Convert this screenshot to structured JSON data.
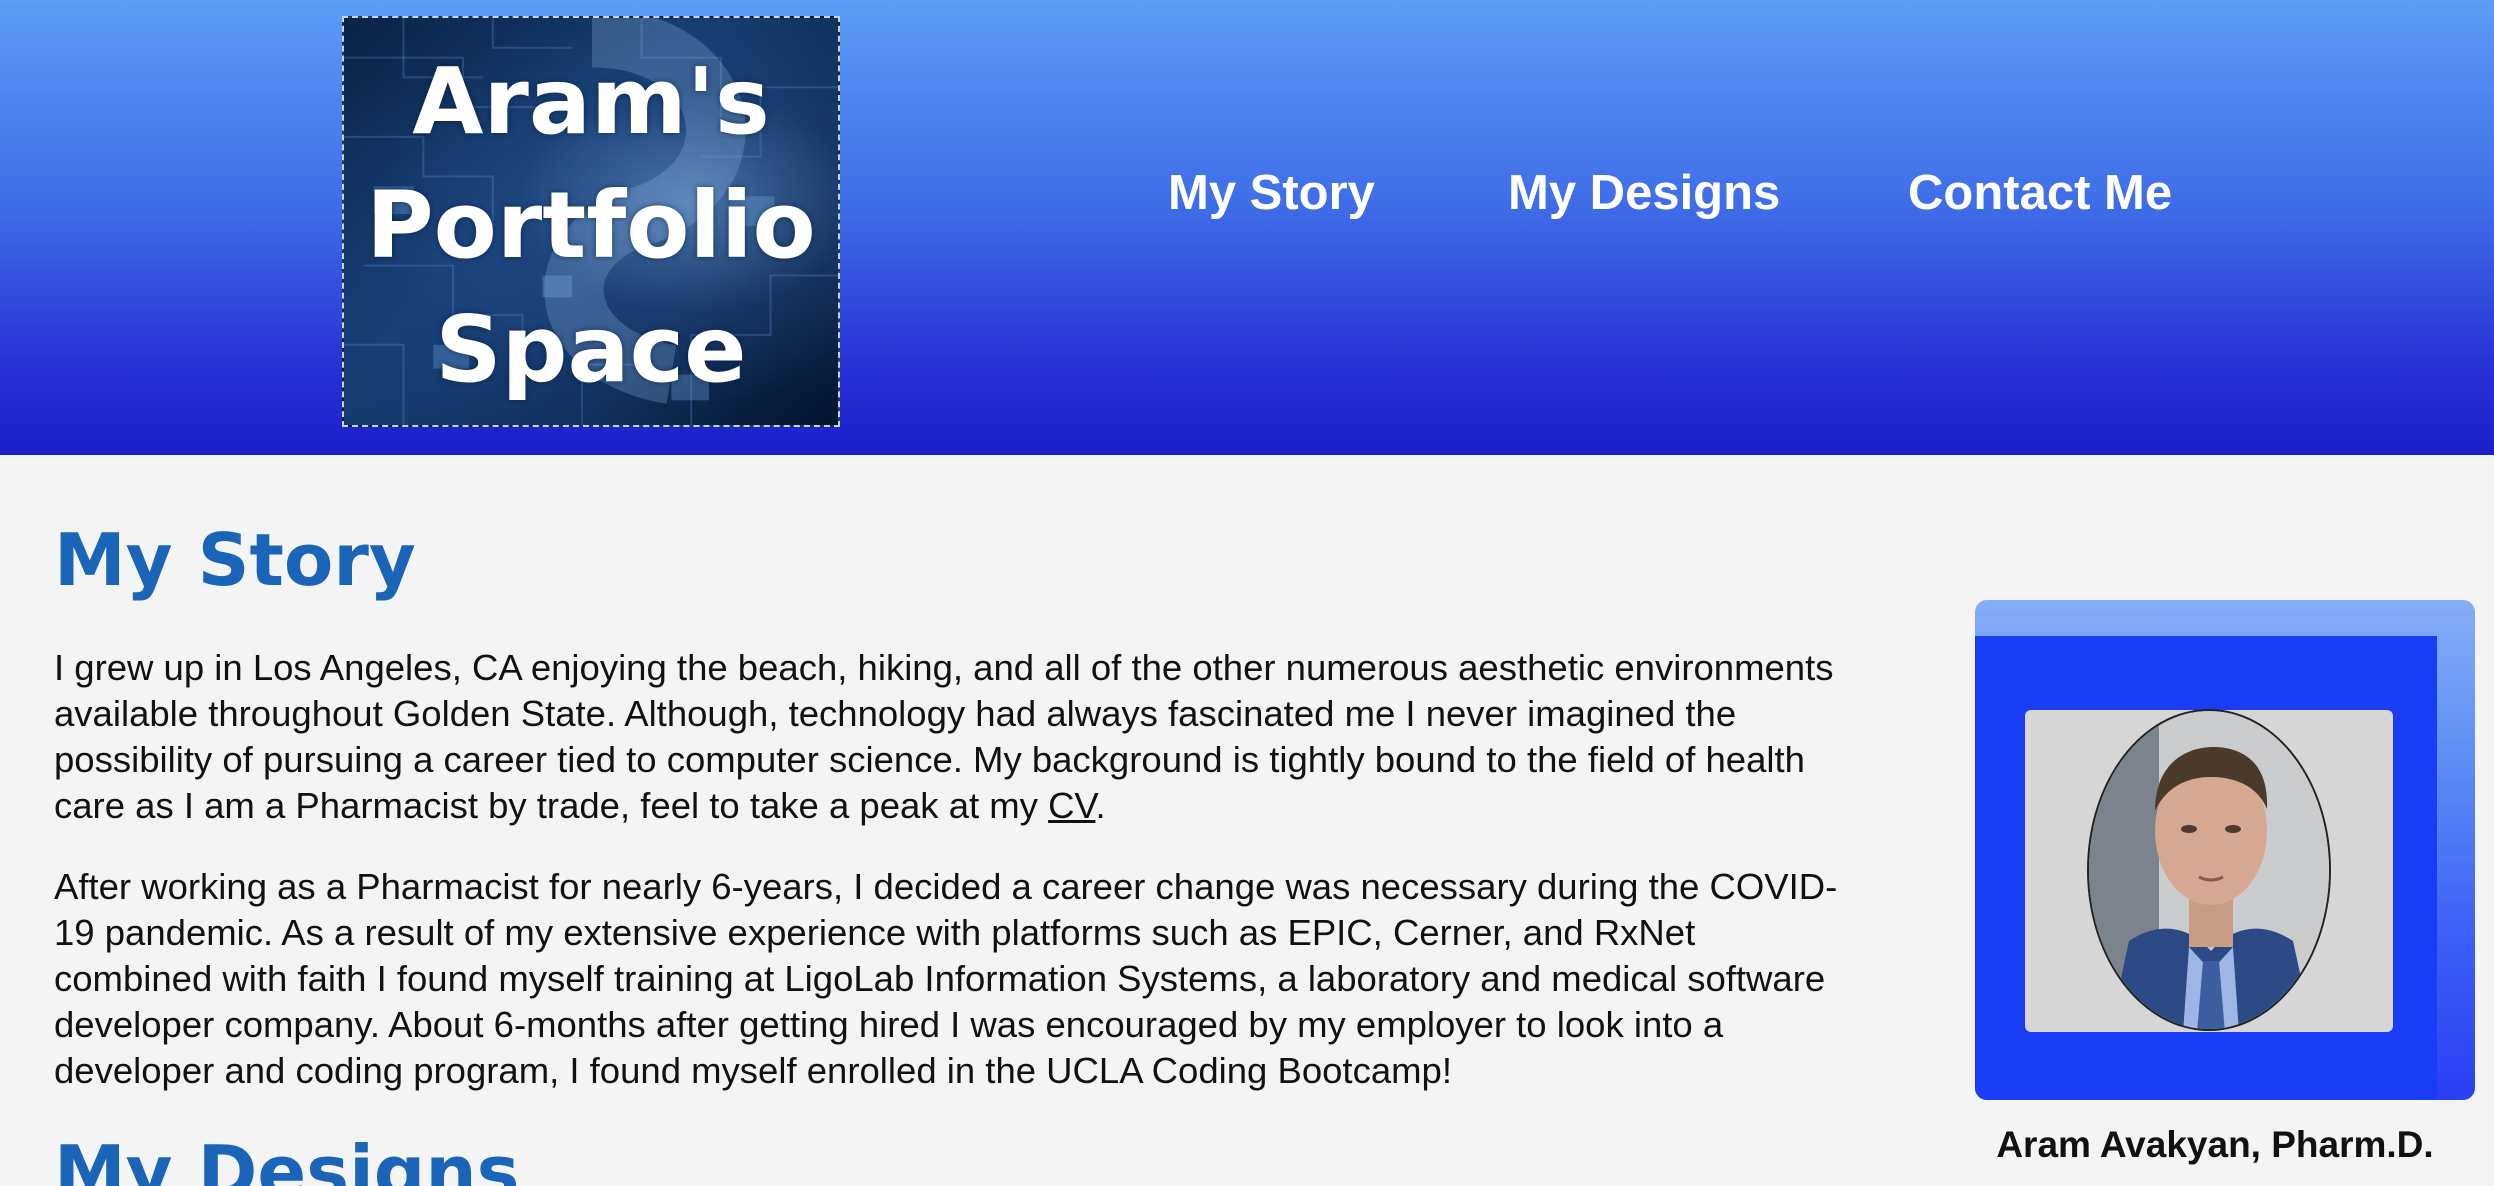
{
  "header": {
    "logo_lines": [
      "Aram's",
      "Portfolio",
      "Space"
    ],
    "nav": [
      {
        "label": "My Story"
      },
      {
        "label": "My Designs"
      },
      {
        "label": "Contact Me"
      }
    ]
  },
  "story": {
    "title": "My Story",
    "paragraph1_before_link": "I grew up in Los Angeles, CA enjoying the beach, hiking, and all of the other numerous aesthetic environments available throughout Golden State. Although, technology had always fascinated me I never imagined the possibility of pursuing a career tied to computer science. My background is tightly bound to the field of health care as I am a Pharmacist by trade, feel to take a peak at my ",
    "cv_link": "CV",
    "paragraph1_after_link": ".",
    "paragraph2": "After working as a Pharmacist for nearly 6-years, I decided a career change was necessary during the COVID-19 pandemic. As a result of my extensive experience with platforms such as EPIC, Cerner, and RxNet combined with faith I found myself training at LigoLab Information Systems, a laboratory and medical software developer company. About 6-months after getting hired I was encouraged by my employer to look into a developer and coding program, I found myself enrolled in the UCLA Coding Bootcamp!"
  },
  "profile": {
    "caption": "Aram Avakyan, Pharm.D."
  },
  "designs": {
    "title": "My Designs"
  },
  "colors": {
    "header_top": "#5b9cf5",
    "header_bottom": "#1a1fca",
    "heading": "#1a65b8",
    "card_inner": "#183df5"
  }
}
